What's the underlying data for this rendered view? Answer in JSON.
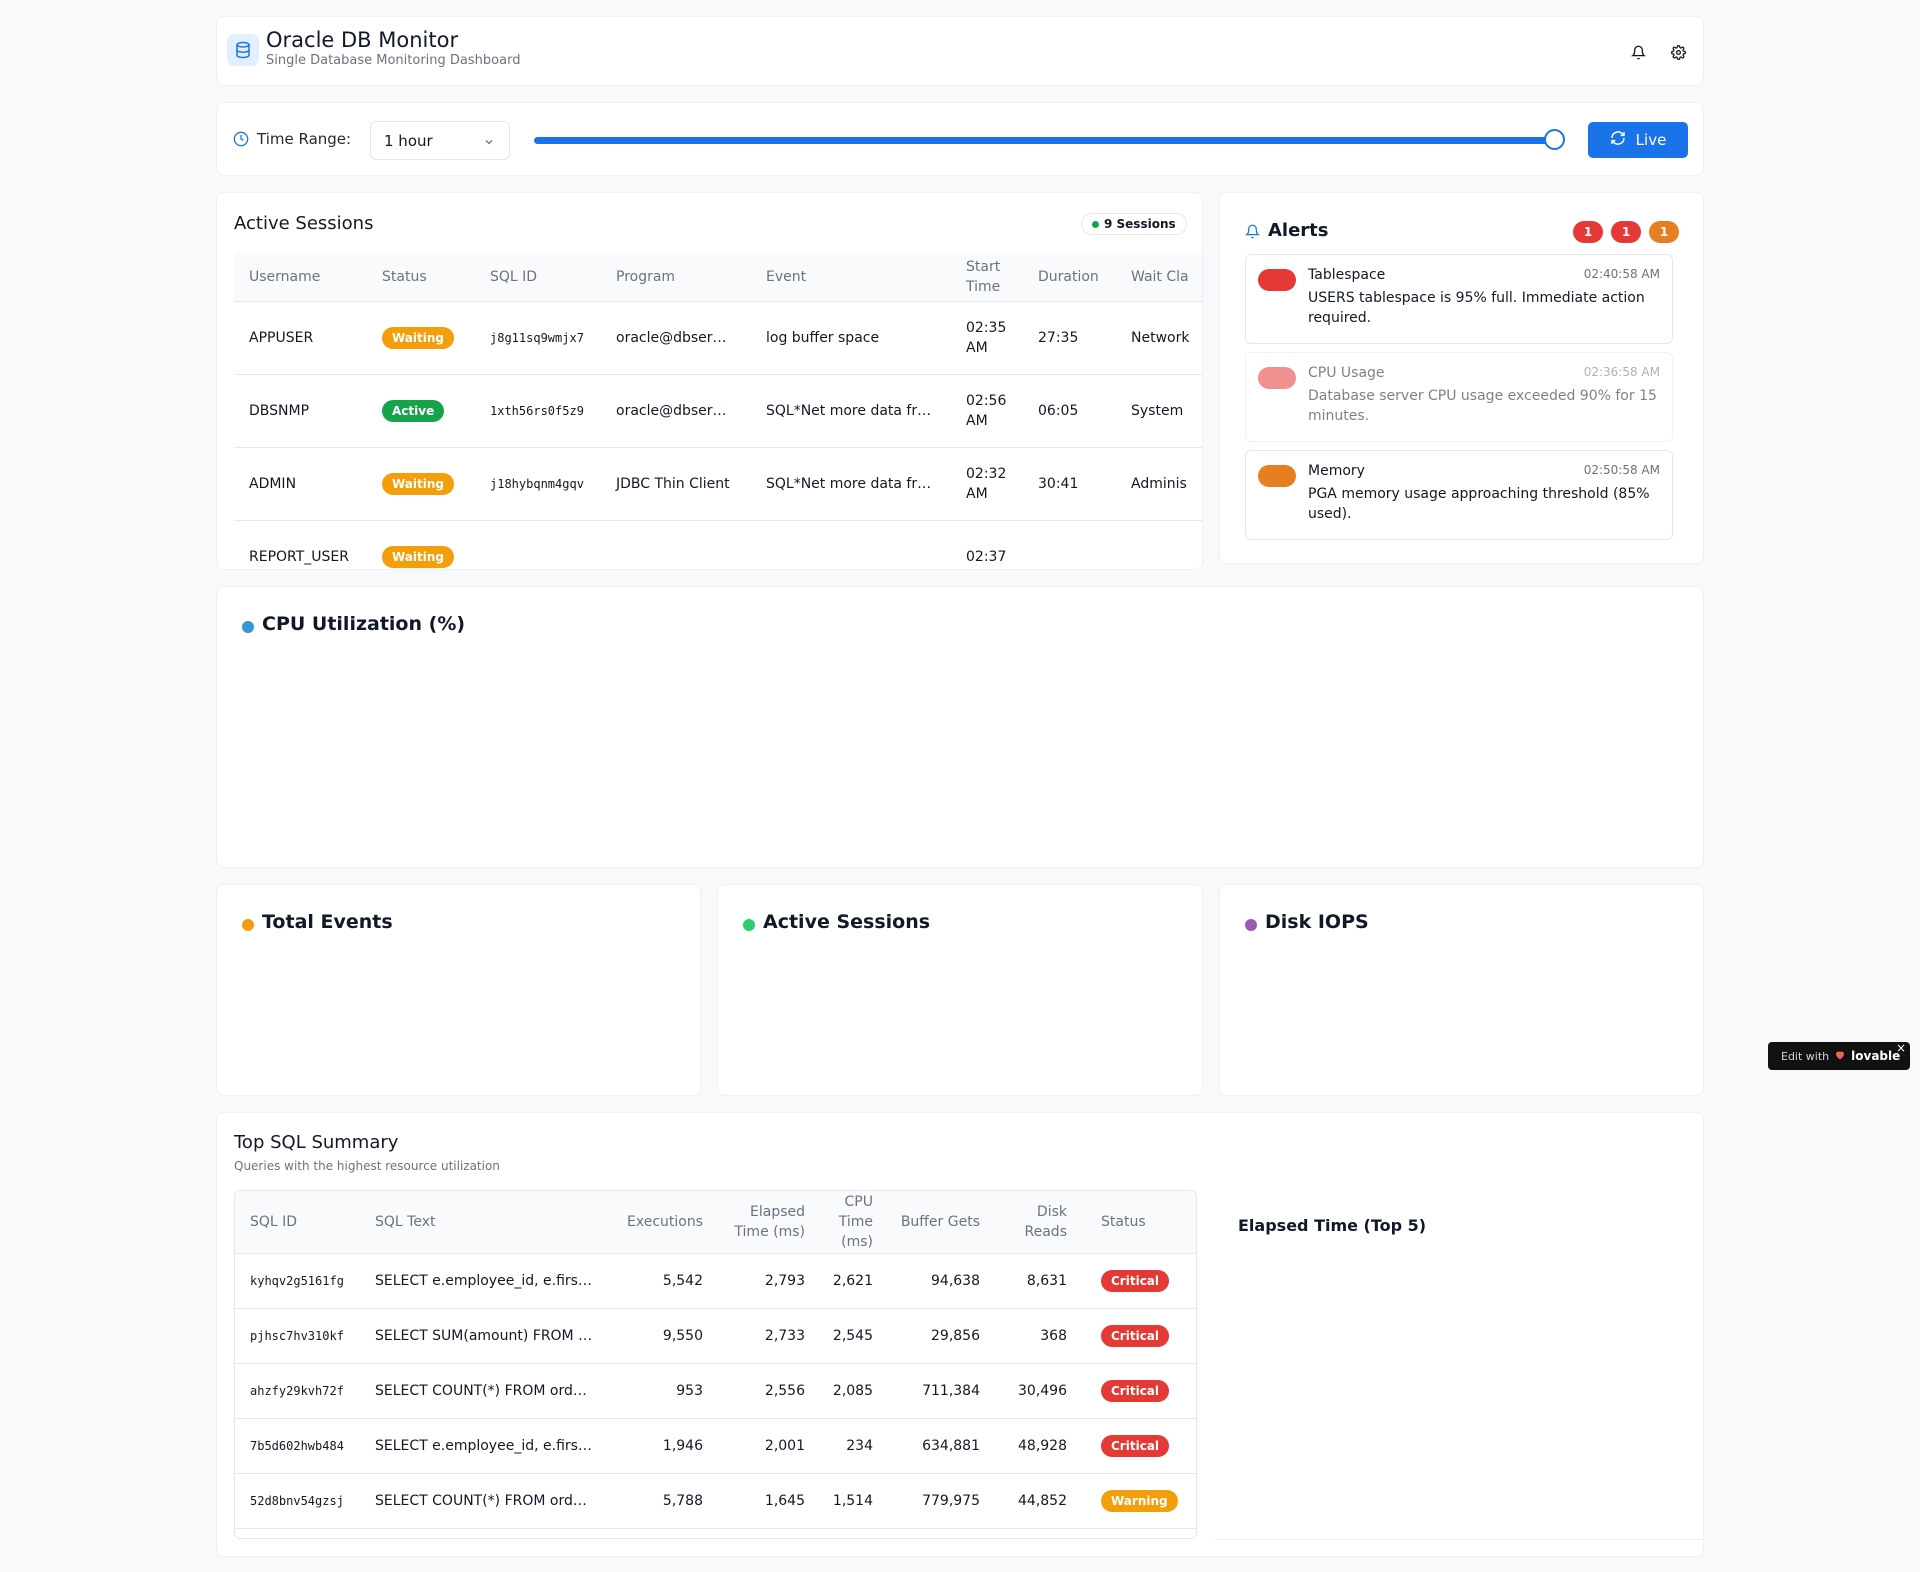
{
  "header": {
    "title": "Oracle DB Monitor",
    "subtitle": "Single Database Monitoring Dashboard",
    "icons": [
      "database-icon",
      "bell-icon",
      "gear-icon"
    ]
  },
  "time_range": {
    "label": "Time Range:",
    "selected": "1 hour",
    "slider_value_percent": 100,
    "live_label": "Live"
  },
  "sessions": {
    "title": "Active Sessions",
    "badge": "9 Sessions",
    "columns": [
      "Username",
      "Status",
      "SQL ID",
      "Program",
      "Event",
      "Start Time",
      "Duration",
      "Wait Cla"
    ],
    "rows": [
      {
        "username": "APPUSER",
        "status": "Waiting",
        "sql_id": "j8g11sq9wmjx7",
        "program": "oracle@dbser…",
        "event": "log buffer space",
        "start": "02:35 AM",
        "duration": "27:35",
        "wait": "Network"
      },
      {
        "username": "DBSNMP",
        "status": "Active",
        "sql_id": "1xth56rs0f5z9",
        "program": "oracle@dbser…",
        "event": "SQL*Net more data fr…",
        "start": "02:56 AM",
        "duration": "06:05",
        "wait": "System"
      },
      {
        "username": "ADMIN",
        "status": "Waiting",
        "sql_id": "j18hybqnm4gqv",
        "program": "JDBC Thin Client",
        "event": "SQL*Net more data fr…",
        "start": "02:32 AM",
        "duration": "30:41",
        "wait": "Adminis"
      },
      {
        "username": "REPORT_USER",
        "status": "Waiting",
        "sql_id": "",
        "program": "",
        "event": "",
        "start": "02:37",
        "duration": "",
        "wait": ""
      }
    ]
  },
  "alerts": {
    "title": "Alerts",
    "counts": [
      "1",
      "1",
      "1"
    ],
    "items": [
      {
        "title": "Tablespace",
        "time": "02:40:58 AM",
        "message": "USERS tablespace is 95% full. Immediate action required."
      },
      {
        "title": "CPU Usage",
        "time": "02:36:58 AM",
        "message": "Database server CPU usage exceeded 90% for 15 minutes."
      },
      {
        "title": "Memory",
        "time": "02:50:58 AM",
        "message": "PGA memory usage approaching threshold (85% used)."
      }
    ]
  },
  "charts": {
    "cpu_title": "CPU Utilization (%)",
    "events_title": "Total Events",
    "active_sessions_title": "Active Sessions",
    "disk_iops_title": "Disk IOPS"
  },
  "top_sql": {
    "title": "Top SQL Summary",
    "subtitle": "Queries with the highest resource utilization",
    "columns": [
      "SQL ID",
      "SQL Text",
      "Executions",
      "Elapsed Time (ms)",
      "CPU Time (ms)",
      "Buffer Gets",
      "Disk Reads",
      "Status"
    ],
    "rows": [
      {
        "sql_id": "kyhqv2g5161fg",
        "text": "SELECT e.employee_id, e.firs…",
        "executions": "5,542",
        "elapsed": "2,793",
        "cpu": "2,621",
        "buffer": "94,638",
        "disk": "8,631",
        "status": "Critical"
      },
      {
        "sql_id": "pjhsc7hv310kf",
        "text": "SELECT SUM(amount) FROM …",
        "executions": "9,550",
        "elapsed": "2,733",
        "cpu": "2,545",
        "buffer": "29,856",
        "disk": "368",
        "status": "Critical"
      },
      {
        "sql_id": "ahzfy29kvh72f",
        "text": "SELECT COUNT(*) FROM ord…",
        "executions": "953",
        "elapsed": "2,556",
        "cpu": "2,085",
        "buffer": "711,384",
        "disk": "30,496",
        "status": "Critical"
      },
      {
        "sql_id": "7b5d602hwb484",
        "text": "SELECT e.employee_id, e.firs…",
        "executions": "1,946",
        "elapsed": "2,001",
        "cpu": "234",
        "buffer": "634,881",
        "disk": "48,928",
        "status": "Critical"
      },
      {
        "sql_id": "52d8bnv54gzsj",
        "text": "SELECT COUNT(*) FROM ord…",
        "executions": "5,788",
        "elapsed": "1,645",
        "cpu": "1,514",
        "buffer": "779,975",
        "disk": "44,852",
        "status": "Warning"
      }
    ],
    "side_title": "Elapsed Time (Top 5)"
  },
  "badge": {
    "prefix": "Edit with",
    "brand": "lovable",
    "close": "×"
  },
  "colors": {
    "primary": "#1a73e8",
    "critical": "#e53935",
    "warning": "#f59e0b",
    "active": "#16a34a"
  }
}
